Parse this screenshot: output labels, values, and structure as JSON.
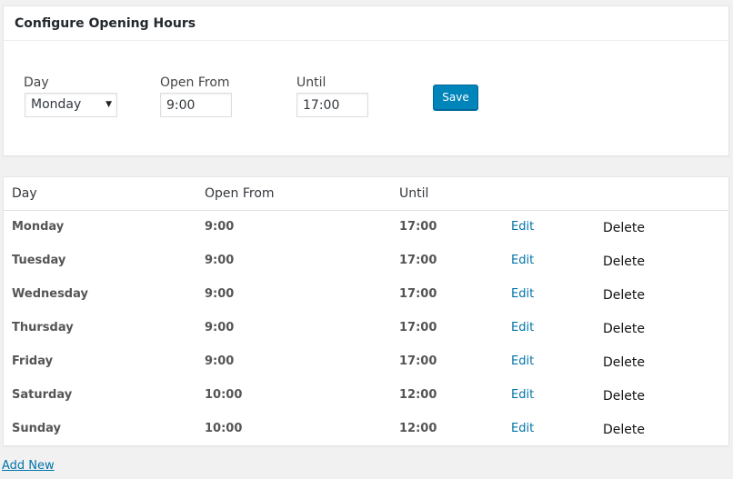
{
  "config": {
    "title": "Configure Opening Hours",
    "day_label": "Day",
    "day_selected": "Monday",
    "open_from_label": "Open From",
    "open_from_value": "9:00",
    "until_label": "Until",
    "until_value": "17:00",
    "save_label": "Save"
  },
  "table": {
    "headers": {
      "day": "Day",
      "open_from": "Open From",
      "until": "Until"
    },
    "edit_label": "Edit",
    "delete_label": "Delete",
    "rows": [
      {
        "day": "Monday",
        "open": "9:00",
        "until": "17:00"
      },
      {
        "day": "Tuesday",
        "open": "9:00",
        "until": "17:00"
      },
      {
        "day": "Wednesday",
        "open": "9:00",
        "until": "17:00"
      },
      {
        "day": "Thursday",
        "open": "9:00",
        "until": "17:00"
      },
      {
        "day": "Friday",
        "open": "9:00",
        "until": "17:00"
      },
      {
        "day": "Saturday",
        "open": "10:00",
        "until": "12:00"
      },
      {
        "day": "Sunday",
        "open": "10:00",
        "until": "12:00"
      }
    ]
  },
  "add_new_label": "Add New",
  "colors": {
    "accent": "#0085ba",
    "link": "#0073aa",
    "background": "#f1f1f1"
  },
  "icons": {
    "select_caret": "caret-down-icon"
  }
}
